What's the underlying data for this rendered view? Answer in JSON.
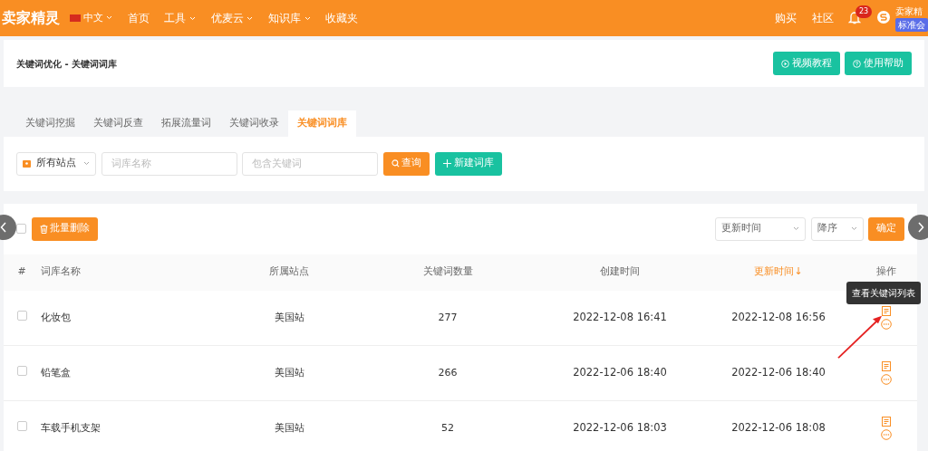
{
  "navbar": {
    "logo": "卖家精灵",
    "language": "中文",
    "menu": [
      {
        "label": "首页",
        "dropdown": false
      },
      {
        "label": "工具",
        "dropdown": true
      },
      {
        "label": "优麦云",
        "dropdown": true
      },
      {
        "label": "知识库",
        "dropdown": true
      },
      {
        "label": "收藏夹",
        "dropdown": false
      }
    ],
    "right_links": [
      "购买",
      "社区"
    ],
    "notification_count": "23",
    "user_name": "卖家精",
    "user_badge": "标准会"
  },
  "breadcrumb": "关键词优化 - 关键词词库",
  "header_buttons": [
    "视频教程",
    "使用帮助"
  ],
  "tabs": [
    {
      "label": "关键词挖掘",
      "selected": false
    },
    {
      "label": "关键词反查",
      "selected": false
    },
    {
      "label": "拓展流量词",
      "selected": false
    },
    {
      "label": "关键词收录",
      "selected": false
    },
    {
      "label": "关键词词库",
      "selected": true
    }
  ],
  "filters": {
    "site": "所有站点",
    "name_placeholder": "词库名称",
    "keyword_placeholder": "包含关键词",
    "query_button": "查询",
    "new_button": "新建词库"
  },
  "toolbar": {
    "select_all_checked": false,
    "bulk_delete": "批量删除",
    "sort_field": "更新时间",
    "sort_order": "降序",
    "confirm": "确定"
  },
  "table": {
    "columns": [
      {
        "label": "#",
        "sorted": false
      },
      {
        "label": "词库名称",
        "sorted": false
      },
      {
        "label": "所属站点",
        "sorted": false
      },
      {
        "label": "关键词数量",
        "sorted": false
      },
      {
        "label": "创建时间",
        "sorted": false
      },
      {
        "label": "更新时间↓",
        "sorted": true
      },
      {
        "label": "操作",
        "sorted": false
      }
    ],
    "rows": [
      {
        "checked": false,
        "name": "化妆包",
        "site": "美国站",
        "count": "277",
        "created": "2022-12-08 16:41",
        "updated": "2022-12-08 16:56"
      },
      {
        "checked": false,
        "name": "铅笔盒",
        "site": "美国站",
        "count": "266",
        "created": "2022-12-06 18:40",
        "updated": "2022-12-06 18:40"
      },
      {
        "checked": false,
        "name": "车载手机支架",
        "site": "美国站",
        "count": "52",
        "created": "2022-12-06 18:03",
        "updated": "2022-12-06 18:08"
      }
    ]
  },
  "tooltip": "查看关键词列表"
}
